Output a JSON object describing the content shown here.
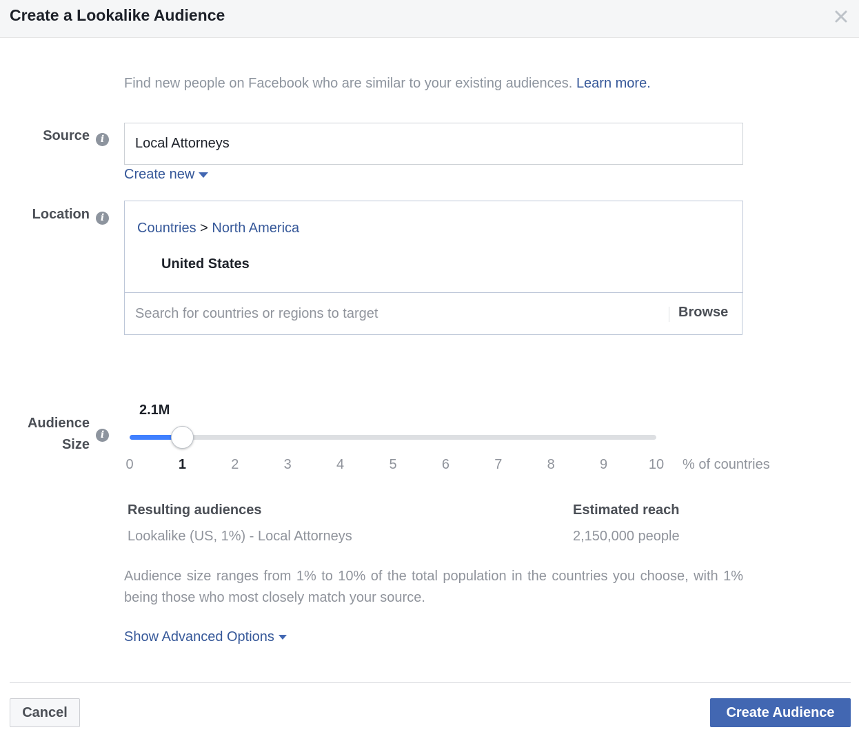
{
  "dialog": {
    "title": "Create a Lookalike Audience",
    "close_icon": "close-icon"
  },
  "intro": {
    "text": "Find new people on Facebook who are similar to your existing audiences.",
    "link": "Learn more."
  },
  "source": {
    "label": "Source",
    "value": "Local Attorneys",
    "create_new": "Create new"
  },
  "location": {
    "label": "Location",
    "breadcrumb_root": "Countries",
    "breadcrumb_separator": ">",
    "breadcrumb_region": "North America",
    "selected_country": "United States",
    "search_placeholder": "Search for countries or regions to target",
    "browse_label": "Browse"
  },
  "audience_size": {
    "label_line1": "Audience",
    "label_line2": "Size",
    "size_display": "2.1M",
    "slider_min": 0,
    "slider_max": 10,
    "slider_value": 1,
    "ticks": [
      "0",
      "1",
      "2",
      "3",
      "4",
      "5",
      "6",
      "7",
      "8",
      "9",
      "10"
    ],
    "active_tick": "1",
    "unit_label": "% of countries"
  },
  "results": {
    "resulting_header": "Resulting audiences",
    "resulting_value": "Lookalike (US, 1%) - Local Attorneys",
    "reach_header": "Estimated reach",
    "reach_value": "2,150,000 people"
  },
  "note": "Audience size ranges from 1% to 10% of the total population in the countries you choose, with 1% being those who most closely match your source.",
  "advanced_options": "Show Advanced Options",
  "footer": {
    "cancel_label": "Cancel",
    "create_label": "Create Audience"
  },
  "colors": {
    "link": "#365899",
    "primary_button": "#4267b2",
    "slider_fill": "#4080ff",
    "muted_text": "#90949c"
  }
}
